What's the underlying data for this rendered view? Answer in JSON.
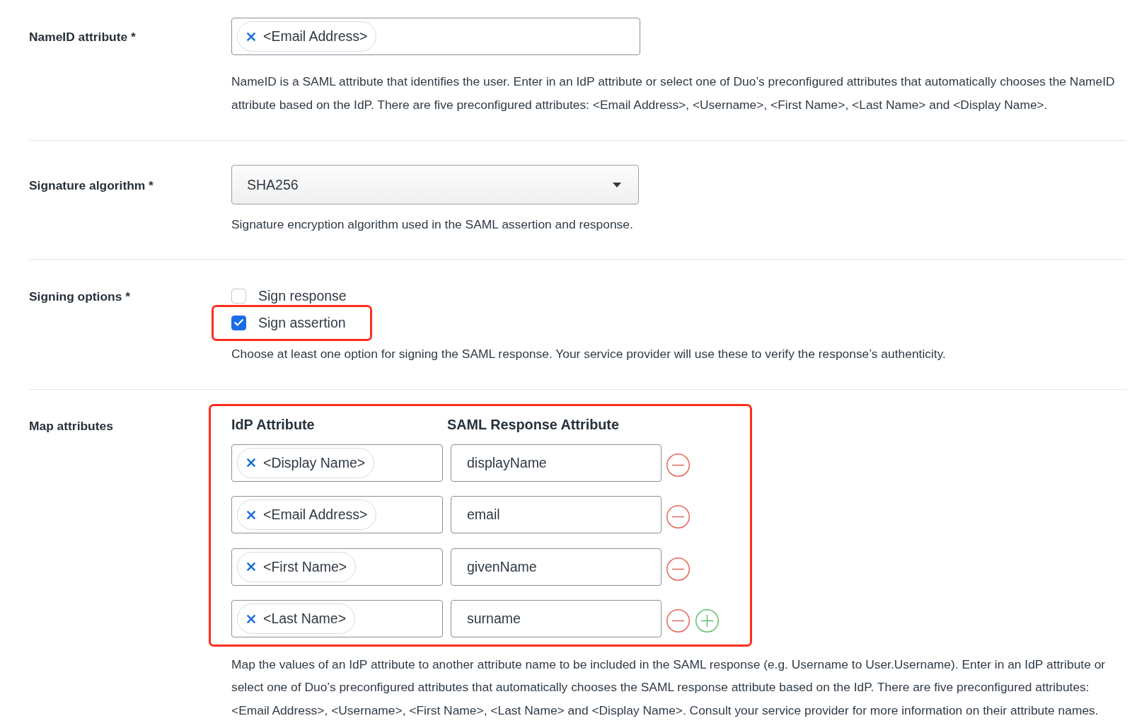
{
  "fields": [
    {
      "kind": "token_input",
      "label": "NameID attribute *",
      "tokens": [
        "<Email Address>"
      ],
      "description": "NameID is a SAML attribute that identifies the user. Enter in an IdP attribute or select one of Duo’s preconfigured attributes that automatically chooses the NameID attribute based on the IdP. There are five preconfigured attributes: <Email Address>, <Username>, <First Name>, <Last Name> and <Display Name>."
    },
    {
      "kind": "select",
      "label": "Signature algorithm *",
      "value": "SHA256",
      "description": "Signature encryption algorithm used in the SAML assertion and response."
    },
    {
      "kind": "checkboxes",
      "label": "Signing options *",
      "options": [
        {
          "label": "Sign response",
          "checked": false,
          "highlighted": false
        },
        {
          "label": "Sign assertion",
          "checked": true,
          "highlighted": true
        }
      ],
      "description": "Choose at least one option for signing the SAML response. Your service provider will use these to verify the response’s authenticity."
    },
    {
      "kind": "attribute_map",
      "label": "Map attributes",
      "highlighted": true,
      "columns": [
        "IdP Attribute",
        "SAML Response Attribute"
      ],
      "rows": [
        {
          "idp_tokens": [
            "<Display Name>"
          ],
          "saml_attribute": "displayName",
          "add_button": false
        },
        {
          "idp_tokens": [
            "<Email Address>"
          ],
          "saml_attribute": "email",
          "add_button": false
        },
        {
          "idp_tokens": [
            "<First Name>"
          ],
          "saml_attribute": "givenName",
          "add_button": false
        },
        {
          "idp_tokens": [
            "<Last Name>"
          ],
          "saml_attribute": "surname",
          "add_button": true
        }
      ],
      "description": "Map the values of an IdP attribute to another attribute name to be included in the SAML response (e.g. Username to User.Username). Enter in an IdP attribute or select one of Duo’s preconfigured attributes that automatically chooses the SAML response attribute based on the IdP. There are five preconfigured attributes: <Email Address>, <Username>, <First Name>, <Last Name> and <Display Name>. Consult your service provider for more information on their attribute names."
    }
  ]
}
